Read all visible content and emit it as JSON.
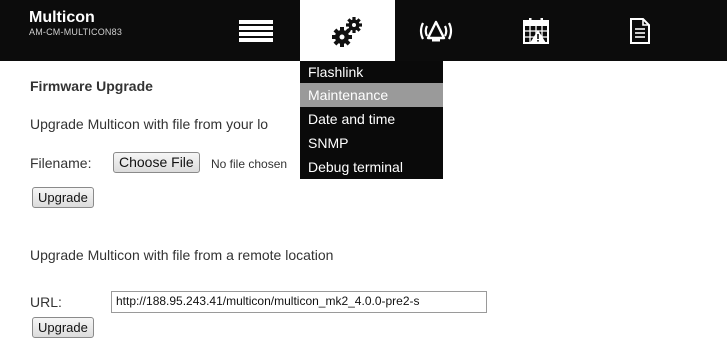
{
  "header": {
    "brand_name": "Multicon",
    "brand_sub": "AM-CM-MULTICON83",
    "nav_icons": [
      "list-icon",
      "gears-icon",
      "alarm-icon",
      "calendar-icon",
      "document-icon"
    ]
  },
  "settings_menu": {
    "items": [
      {
        "label": "Flashlink"
      },
      {
        "label": "Maintenance"
      },
      {
        "label": "Date and time"
      },
      {
        "label": "SNMP"
      },
      {
        "label": "Debug terminal"
      }
    ]
  },
  "firmware": {
    "title": "Firmware Upgrade",
    "local_intro": "Upgrade Multicon with file from your lo",
    "filename_label": "Filename:",
    "choose_file_label": "Choose File",
    "no_file_text": "No file chosen",
    "upgrade_label": "Upgrade",
    "remote_intro": "Upgrade Multicon with file from a remote location",
    "url_label": "URL:",
    "url_value": "http://188.95.243.41/multicon/multicon_mk2_4.0.0-pre2-s",
    "remote_upgrade_label": "Upgrade"
  },
  "colors": {
    "topbar": "#0c0c0c",
    "menu_bg": "#0a0a0a",
    "menu_selected": "#9a9a9a"
  }
}
